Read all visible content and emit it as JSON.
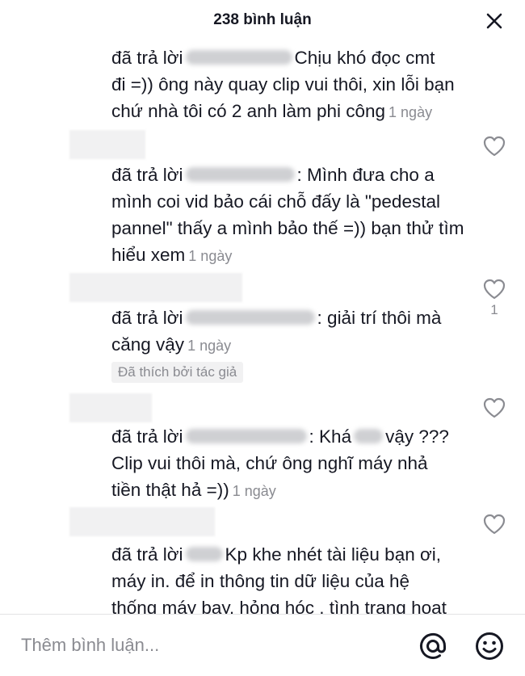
{
  "header": {
    "title": "238 bình luận"
  },
  "comments": [
    {
      "reply_prefix": "đã trả lời",
      "line1": "Chịu khó đọc cmt",
      "line2": "đi =)) ông này quay clip vui thôi, xin lỗi bạn",
      "line3": "chứ nhà tôi có 2 anh làm phi công",
      "time": "1 ngày"
    },
    {
      "reply_prefix": "đã trả lời",
      "line1": ": Mình đưa cho a",
      "line2": "mình coi vid bảo cái chỗ đấy là \"pedestal",
      "line3": "pannel\" thấy a mình bảo thế =)) bạn thử tìm",
      "line4": "hiểu xem",
      "time": "1 ngày"
    },
    {
      "reply_prefix": "đã trả lời",
      "line1": ": giải trí thôi mà",
      "line2": "căng vậy",
      "time": "1 ngày",
      "badge": "Đã thích bởi tác giả",
      "like_count": "1"
    },
    {
      "reply_prefix": "đã trả lời",
      "line1a": ": Khá",
      "line1b": "vậy ???",
      "line2": "Clip vui thôi mà, chứ ông nghĩ máy nhả",
      "line3": "tiền thật hả =))",
      "time": "1 ngày"
    },
    {
      "reply_prefix": "đã trả lời",
      "line1": "Kp khe nhét tài liệu bạn ơi,",
      "line2": "máy in. để in thông tin dữ liệu của hệ",
      "line3": "thống máy bay, hỏng hóc , tình trạng hoạt"
    }
  ],
  "footer": {
    "placeholder": "Thêm bình luận..."
  },
  "icons": {
    "close": "close-icon",
    "heart": "heart-outline-icon",
    "mention": "at-icon",
    "emoji": "emoji-icon"
  },
  "colors": {
    "text": "#161823",
    "secondary": "#8a8b91",
    "badge_bg": "#f1f1f2"
  }
}
